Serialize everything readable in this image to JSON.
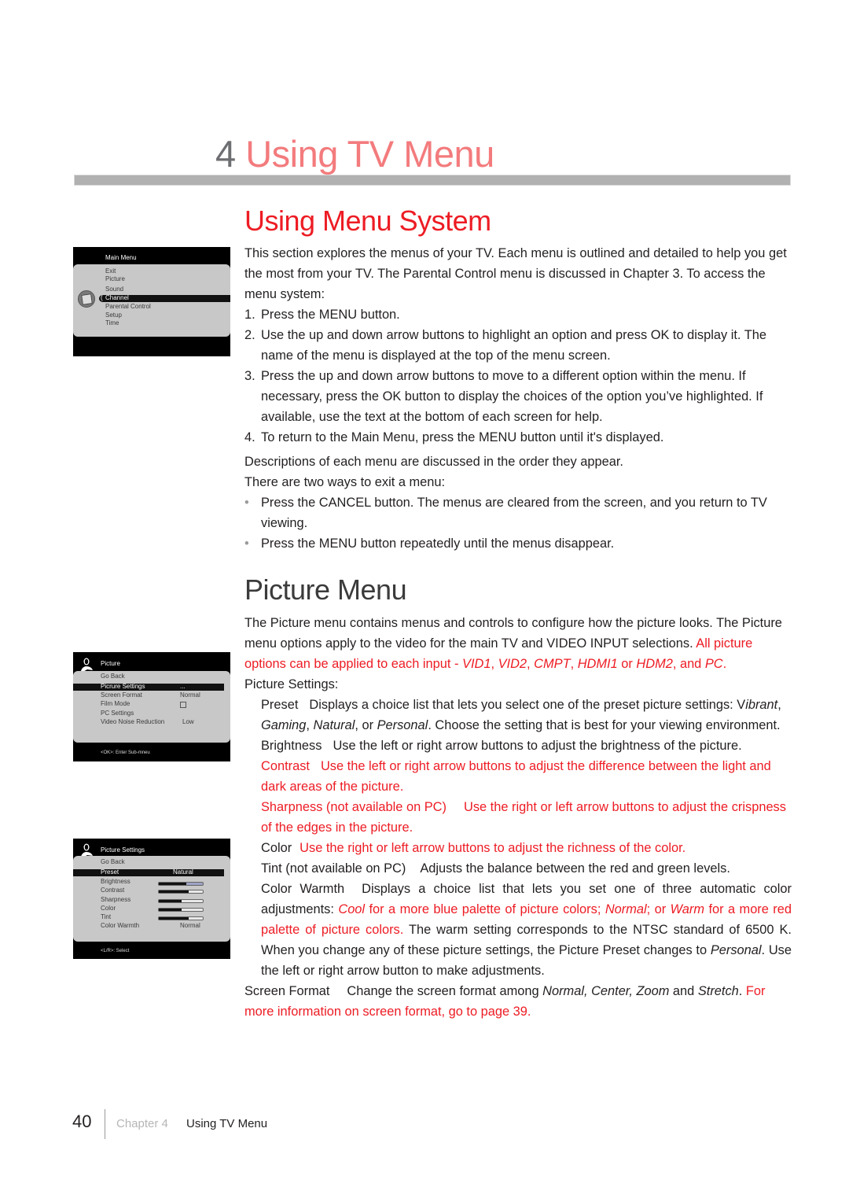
{
  "chapter": {
    "number": "4",
    "title": "Using TV Menu"
  },
  "section_menu_system": {
    "heading": "Using Menu System",
    "intro": "This section explores the menus of your TV. Each menu is outlined and detailed to help you get the most from your TV. The Parental Control menu is discussed in Chapter 3. To access the menu system:",
    "steps": [
      {
        "num": "1.",
        "text": "Press the MENU button."
      },
      {
        "num": "2.",
        "text": "Use the up and down arrow buttons to highlight an option and press OK to display it. The name of the menu is displayed at the top of the menu screen."
      },
      {
        "num": "3.",
        "text": "Press the up and down arrow buttons to move to a different option within the menu. If necessary, press the OK button to display the choices of the option you’ve highlighted. If available, use the text at the bottom of each screen for help."
      },
      {
        "num": "4.",
        "text": "To return to the Main Menu, press the MENU button until it's displayed."
      }
    ],
    "descriptions_note": "Descriptions of each menu are discussed in the order they appear.",
    "exit_intro": "There are two ways to exit a menu:",
    "bullets": [
      "Press the CANCEL button. The menus are cleared from the screen, and you return to TV viewing.",
      "Press the MENU button repeatedly until the menus disappear."
    ],
    "bullet_glyph": "•"
  },
  "section_picture_menu": {
    "heading": "Picture Menu",
    "intro_black": "The Picture menu contains menus and controls to configure how the picture looks. The Picture menu options apply to the video for the main TV and VIDEO INPUT selections. ",
    "intro_red_1": "All picture options can be applied to each input - ",
    "inputs": {
      "vid1": "VID1",
      "sep1": ", ",
      "vid2": "VID2",
      "sep2": ", ",
      "cmpt": "CMPT",
      "sep3": ", ",
      "hdmi1": "HDMI1",
      "or": " or ",
      "hdm2": "HDM2",
      "and": ", and ",
      "pc": "PC",
      "end": "."
    },
    "settings_label": "Picture Settings:",
    "preset": {
      "term": "Preset",
      "text_1": "Displays a choice list that lets you select one of the preset picture settings: V",
      "opt_vibrant": "ibrant",
      "c1": ", ",
      "opt_gaming": "Gaming",
      "c2": ", ",
      "opt_natural": "Natural",
      "c3": ", or ",
      "opt_personal": "Personal",
      "text_2": ". Choose the setting that is best for your viewing environment."
    },
    "brightness": {
      "term": "Brightness",
      "text": "Use the left or right arrow buttons to adjust the brightness of the picture."
    },
    "contrast": {
      "term": "Contrast",
      "text": "Use the left or right arrow buttons to adjust the difference between the light and dark areas of the picture."
    },
    "sharpness": {
      "term": "Sharpness (not available on PC)",
      "text": "Use the right or left arrow buttons to adjust the crispness of the edges in the picture."
    },
    "color": {
      "term": "Color",
      "text": "Use the right or left arrow buttons to adjust the richness of the color."
    },
    "tint": {
      "term": "Tint (not available on PC)",
      "text": "Adjusts the balance between the red and green levels."
    },
    "color_warmth": {
      "term": "Color Warmth",
      "text_1": "Displays a choice list that lets you set one of three automatic color adjustments: ",
      "opt_cool": "Cool",
      "r1": " for a more blue palette of picture colors; ",
      "opt_normal": "Normal",
      "r2": "; or ",
      "opt_warm": "Warm",
      "r3": " for a more red palette of picture colors.",
      "text_2": " The warm setting corresponds to the NTSC standard of 6500 K. When you change any of these picture settings, the Picture Preset changes to ",
      "opt_personal": "Personal",
      "text_3": ".  Use the left or right arrow button to make adjustments."
    },
    "screen_format": {
      "term": "Screen Format",
      "text_1": "Change the screen format among ",
      "opts": "Normal, Center, Zoom",
      "and": " and ",
      "opt_stretch": "Stretch",
      "dot": ". ",
      "red": "For more information on screen format, go to page 39."
    }
  },
  "tv_main_menu": {
    "title": "Main Menu",
    "items": [
      "Exit",
      "Picture",
      "Sound",
      "Channel",
      "Parental Control",
      "Setup",
      "Time"
    ],
    "selected": "Channel",
    "selected_marker": "(",
    "icon": "disc-icon"
  },
  "tv_picture_menu": {
    "title": "Picture",
    "go_back": "Go Back",
    "items": [
      {
        "label": "Picrure Settings",
        "value": "..."
      },
      {
        "label": "Screen Format",
        "value": "Normal"
      },
      {
        "label": "Film Mode",
        "value": ""
      },
      {
        "label": "PC Settings",
        "value": ""
      },
      {
        "label": "Video Noise Reduction",
        "value": "Low"
      }
    ],
    "film_mode_checked": false,
    "footer": "<OK>: Enter Sub-mneu",
    "icon": "person-icon"
  },
  "tv_picture_settings": {
    "title": "Picture Settings",
    "go_back": "Go Back",
    "preset_label": "Preset",
    "preset_value": "Natural",
    "sliders": [
      {
        "label": "Brightness",
        "level": 0.62
      },
      {
        "label": "Contrast",
        "level": 0.67
      },
      {
        "label": "Sharpness",
        "level": 0.52
      },
      {
        "label": "Color",
        "level": 0.51
      },
      {
        "label": "Tint",
        "level": 0.68
      }
    ],
    "color_warmth_label": "Color Warmth",
    "color_warmth_value": "Normal",
    "footer": "<L/R>: Select",
    "icon": "person-icon"
  },
  "footer": {
    "page_number": "40",
    "chapter_label": "Chapter 4",
    "chapter_title": "Using TV Menu"
  }
}
